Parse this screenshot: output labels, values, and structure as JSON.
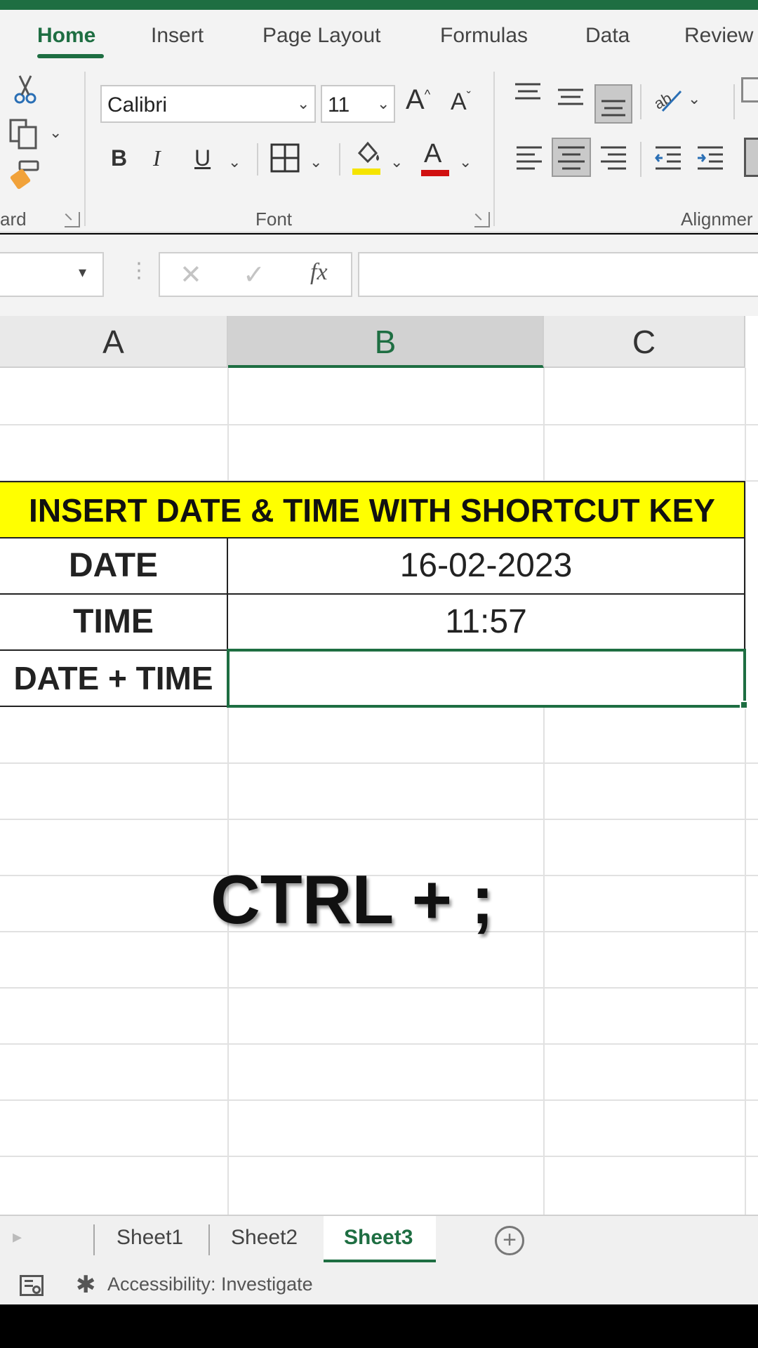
{
  "ribbon_tabs": [
    "Home",
    "Insert",
    "Page Layout",
    "Formulas",
    "Data",
    "Review"
  ],
  "ribbon": {
    "font_name": "Calibri",
    "font_size": "11",
    "group_clipboard_label": "ard",
    "group_font_label": "Font",
    "group_alignment_label": "Alignmer"
  },
  "formula_bar": {
    "fx_label": "fx",
    "formula_value": ""
  },
  "grid": {
    "columns": [
      "A",
      "B",
      "C"
    ],
    "selected_column": "B",
    "title": "INSERT DATE & TIME WITH SHORTCUT KEY",
    "rows": [
      {
        "label": "DATE",
        "value": "16-02-2023"
      },
      {
        "label": "TIME",
        "value": "11:57"
      },
      {
        "label": "DATE + TIME",
        "value": ""
      }
    ]
  },
  "overlay_text": "CTRL + ;",
  "sheet_tabs": [
    "Sheet1",
    "Sheet2",
    "Sheet3"
  ],
  "active_sheet": "Sheet3",
  "status": {
    "accessibility": "Accessibility: Investigate"
  },
  "colors": {
    "accent": "#1e6e42",
    "title_fill": "#ffff00",
    "font_color": "#d01010",
    "highlight": "#f5e400"
  }
}
